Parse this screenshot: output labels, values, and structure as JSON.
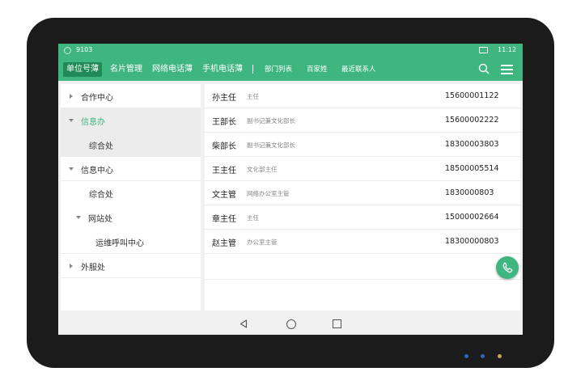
{
  "status": {
    "extension": "9103",
    "time": "11:12"
  },
  "tabs": [
    {
      "label": "单位号薄",
      "active": true
    },
    {
      "label": "名片管理"
    },
    {
      "label": "网络电话薄"
    },
    {
      "label": "手机电话薄"
    },
    {
      "label": "部门列表"
    },
    {
      "label": "百家姓"
    },
    {
      "label": "最近联系人"
    }
  ],
  "tree": [
    {
      "label": "合作中心",
      "expand": "collapsed"
    },
    {
      "label": "信息办",
      "expand": "expanded",
      "selected": true
    },
    {
      "label": "综合处"
    },
    {
      "label": "信息中心",
      "expand": "expanded"
    },
    {
      "label": "综合处"
    },
    {
      "label": "网站处",
      "expand": "expanded"
    },
    {
      "label": "运维呼叫中心"
    },
    {
      "label": "外服处",
      "expand": "collapsed"
    }
  ],
  "contacts": [
    {
      "name": "孙主任",
      "title": "主任",
      "phone": "15600001122"
    },
    {
      "name": "王部长",
      "title": "副书记兼文化部长",
      "phone": "15600002222"
    },
    {
      "name": "柴部长",
      "title": "副书记兼文化部长",
      "phone": "18300003803"
    },
    {
      "name": "王主任",
      "title": "文化部主任",
      "phone": "18500005514"
    },
    {
      "name": "文主管",
      "title": "网络办公室主管",
      "phone": "1830000803"
    },
    {
      "name": "章主任",
      "title": "主任",
      "phone": "15000002664"
    },
    {
      "name": "赵主管",
      "title": "办公室主管",
      "phone": "18300000803"
    }
  ],
  "colors": {
    "accent": "#3fb580",
    "accent_dark": "#1f8a55",
    "selected_text": "#3fb580"
  },
  "icons": [
    "wifi-icon",
    "signal-icon",
    "search-icon",
    "menu-icon",
    "phone-icon",
    "back-icon",
    "home-icon",
    "recent-icon"
  ]
}
